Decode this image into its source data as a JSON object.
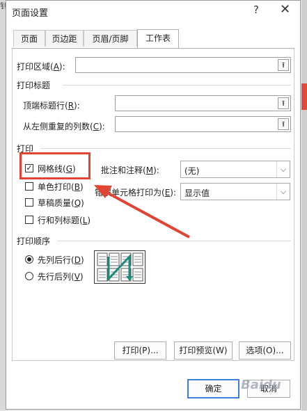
{
  "background": {
    "corner_glyph": "钊"
  },
  "dialog": {
    "title": "页面设置",
    "help": "?",
    "close": "✕",
    "tabs": [
      "页面",
      "页边距",
      "页眉/页脚",
      "工作表"
    ],
    "active_tab": "工作表"
  },
  "print_area": {
    "label": "打印区域",
    "key": "A",
    "value": ""
  },
  "print_titles": {
    "heading": "打印标题",
    "rows_label": "顶端标题行",
    "rows_key": "R",
    "rows_value": "",
    "cols_label": "从左侧重复的列数",
    "cols_key": "C",
    "cols_value": ""
  },
  "print": {
    "heading": "打印",
    "gridlines": {
      "label": "网格线",
      "key": "G",
      "checked": true
    },
    "mono": {
      "label": "单色打印",
      "key": "B",
      "checked": false
    },
    "draft": {
      "label": "草稿质量",
      "key": "Q",
      "checked": false
    },
    "headings": {
      "label": "行和列标题",
      "key": "L",
      "checked": false
    },
    "comments": {
      "label": "批注和注释",
      "key": "M",
      "value": "(无)"
    },
    "errors": {
      "label": "错误单元格打印为",
      "key": "E",
      "value": "显示值"
    }
  },
  "order": {
    "heading": "打印顺序",
    "down_then_over": {
      "label": "先列后行",
      "key": "D",
      "selected": true
    },
    "over_then_down": {
      "label": "先行后列",
      "key": "V",
      "selected": false
    }
  },
  "buttons": {
    "print": "打印(P)...",
    "preview": "打印预览(W)",
    "options": "选项(O)...",
    "ok": "确定",
    "cancel": "取消"
  },
  "watermark": "Baidu",
  "annotation_color": "#e04433"
}
